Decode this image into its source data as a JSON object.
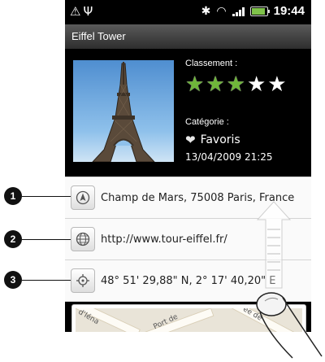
{
  "status_bar": {
    "left_icons": [
      "alert-icon",
      "usb-icon"
    ],
    "right_icons": [
      "bluetooth-icon",
      "wifi-icon",
      "signal-icon",
      "battery-icon"
    ],
    "time": "19:44"
  },
  "title": "Eiffel Tower",
  "header": {
    "rating_label": "Classement :",
    "rating": 3,
    "rating_max": 5,
    "category_label": "Catégorie :",
    "category_value": "Favoris",
    "datetime": "13/04/2009 21:25"
  },
  "rows": [
    {
      "icon": "navigation-icon",
      "text": "Champ de Mars, 75008 Paris, France"
    },
    {
      "icon": "globe-icon",
      "text": "http://www.tour-eiffel.fr/"
    },
    {
      "icon": "gps-target-icon",
      "text": "48° 51' 29,88\" N, 2° 17' 40,20\" E"
    }
  ],
  "map": {
    "streets": [
      "d'Iéna",
      "Port de",
      "ee de"
    ]
  },
  "callouts": [
    "1",
    "2",
    "3"
  ],
  "colors": {
    "star_on": "#6fb63a",
    "star_off": "#ffffff",
    "battery": "#7fc24a"
  }
}
